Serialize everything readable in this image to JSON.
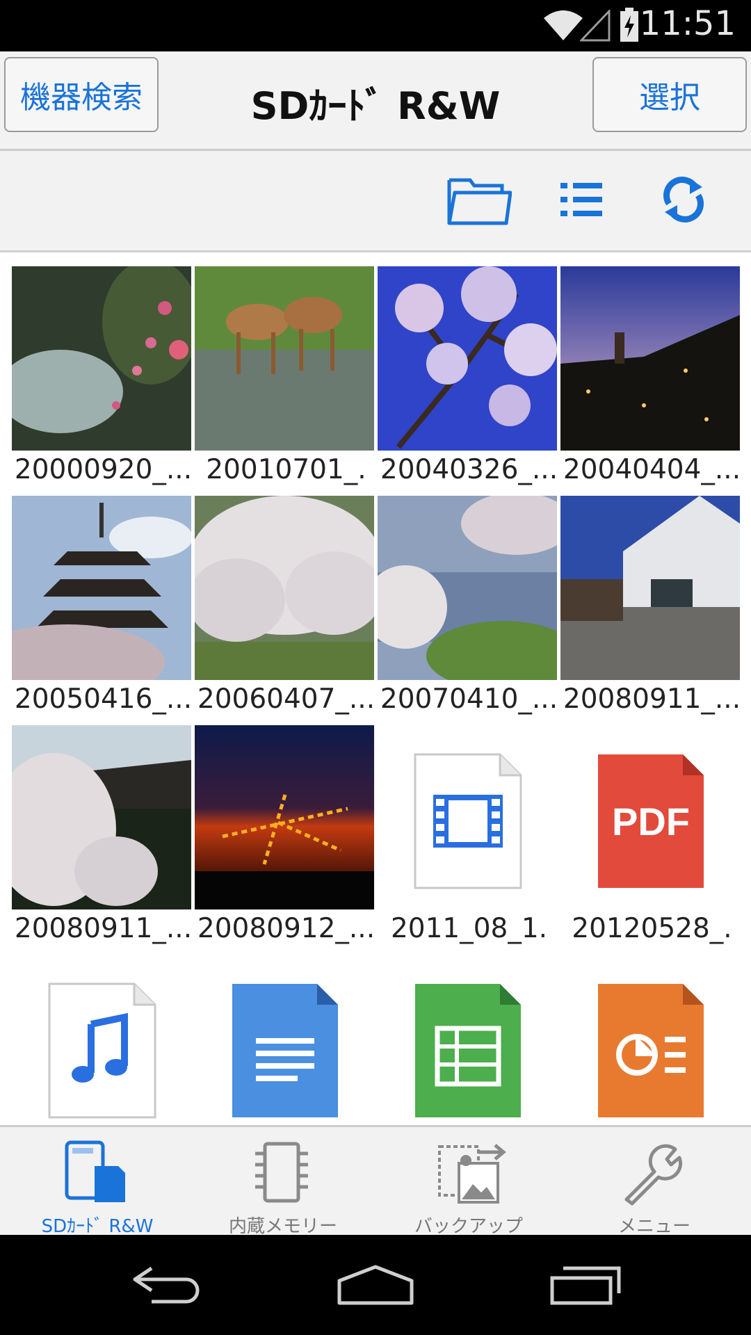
{
  "status_bar": {
    "time": "11:51",
    "icons": [
      "wifi-icon",
      "signal-icon",
      "battery-charging-icon"
    ]
  },
  "header": {
    "left_button": "機器検索",
    "title": "SDｶｰﾄﾞ R&W",
    "right_button": "選択",
    "accent_color": "#1a73d8"
  },
  "toolbar": {
    "icons": [
      "folder-icon",
      "list-view-icon",
      "refresh-icon"
    ]
  },
  "files": [
    {
      "name": "20000920_...",
      "type": "image"
    },
    {
      "name": "20010701_.",
      "type": "image"
    },
    {
      "name": "20040326_...",
      "type": "image"
    },
    {
      "name": "20040404_...",
      "type": "image"
    },
    {
      "name": "20050416_...",
      "type": "image"
    },
    {
      "name": "20060407_...",
      "type": "image"
    },
    {
      "name": "20070410_...",
      "type": "image"
    },
    {
      "name": "20080911_...",
      "type": "image"
    },
    {
      "name": "20080911_...",
      "type": "image"
    },
    {
      "name": "20080912_...",
      "type": "image"
    },
    {
      "name": "2011_08_1.",
      "type": "video"
    },
    {
      "name": "20120528_.",
      "type": "pdf"
    },
    {
      "name": "",
      "type": "audio"
    },
    {
      "name": "",
      "type": "document"
    },
    {
      "name": "",
      "type": "spreadsheet"
    },
    {
      "name": "",
      "type": "presentation"
    }
  ],
  "bottom_nav": [
    {
      "label": "SDｶｰﾄﾞ R&W",
      "icon": "sd-card-device-icon",
      "active": true
    },
    {
      "label": "内蔵メモリー",
      "icon": "memory-chip-icon",
      "active": false
    },
    {
      "label": "バックアップ",
      "icon": "backup-icon",
      "active": false
    },
    {
      "label": "メニュー",
      "icon": "wrench-icon",
      "active": false
    }
  ],
  "system_nav": [
    "back-icon",
    "home-icon",
    "recents-icon"
  ]
}
